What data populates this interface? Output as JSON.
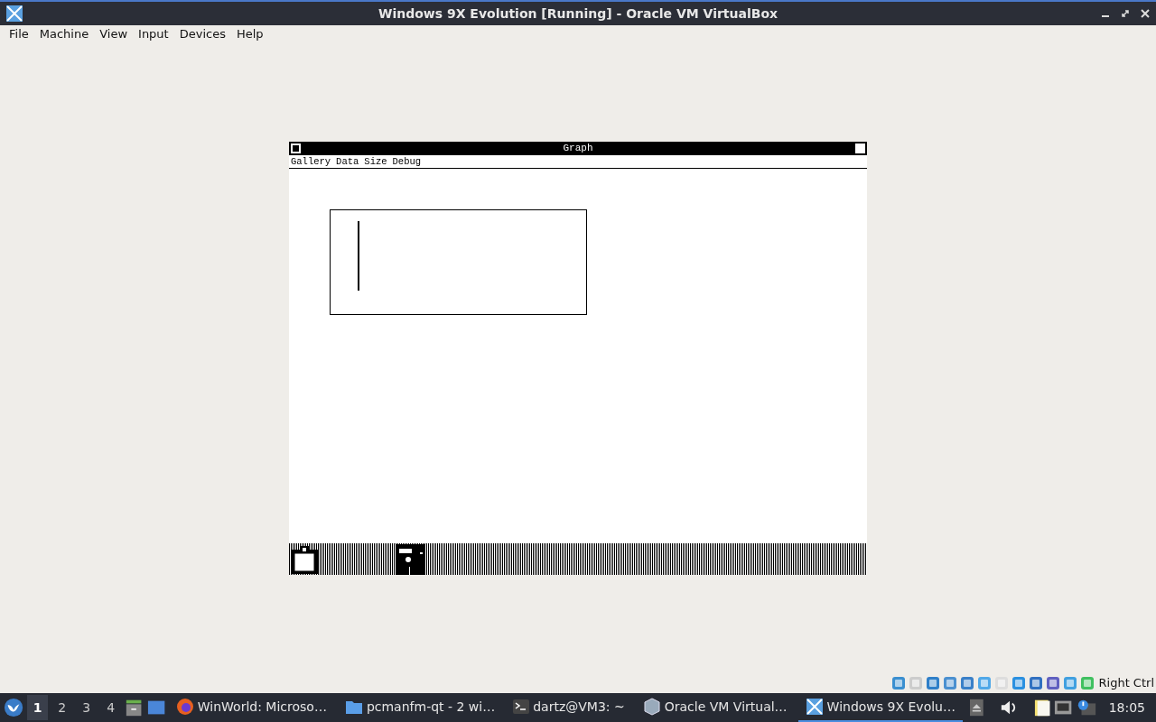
{
  "window": {
    "title": "Windows 9X Evolution [Running] - Oracle VM VirtualBox"
  },
  "menu": [
    "File",
    "Machine",
    "View",
    "Input",
    "Devices",
    "Help"
  ],
  "guest": {
    "window_title": "Graph",
    "menu": [
      "Gallery",
      "Data",
      "Size",
      "Debug"
    ]
  },
  "status_bar": {
    "host_key": "Right Ctrl"
  },
  "taskbar": {
    "workspaces": [
      {
        "label": "1",
        "selected": true
      },
      {
        "label": "2",
        "selected": false
      },
      {
        "label": "3",
        "selected": false
      },
      {
        "label": "4",
        "selected": false
      }
    ],
    "tasks": [
      {
        "kind": "browser",
        "label": "WinWorld: Microso…",
        "selected": false
      },
      {
        "kind": "folder",
        "label": "pcmanfm-qt - 2 wi…",
        "selected": false
      },
      {
        "kind": "terminal",
        "label": "dartz@VM3: ~",
        "selected": false
      },
      {
        "kind": "vbox",
        "label": "Oracle VM Virtual…",
        "selected": false
      },
      {
        "kind": "vm",
        "label": "Windows 9X Evolu…",
        "selected": true
      }
    ],
    "clock": "18:05"
  }
}
